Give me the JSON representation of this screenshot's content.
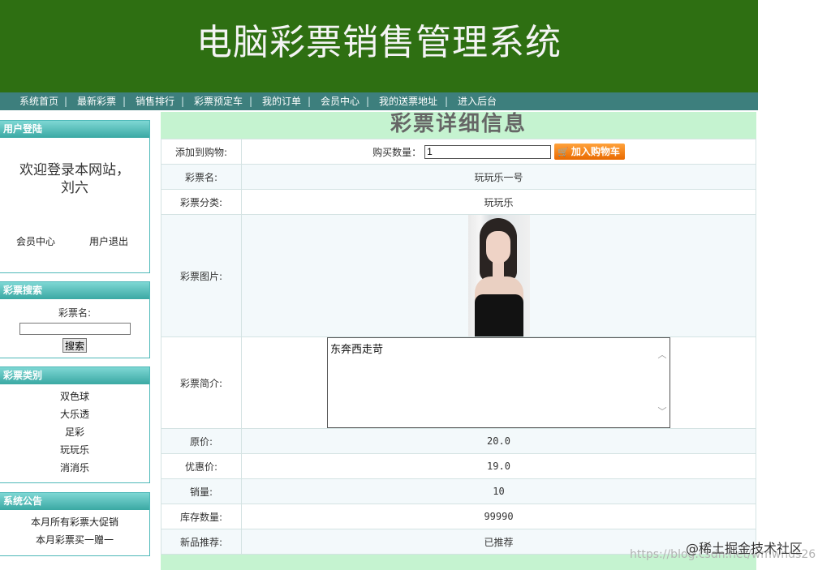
{
  "header": {
    "title": "电脑彩票销售管理系统"
  },
  "nav": {
    "items": [
      "系统首页",
      "最新彩票",
      "销售排行",
      "彩票预定车",
      "我的订单",
      "会员中心",
      "我的送票地址",
      "进入后台"
    ]
  },
  "login": {
    "title": "用户登陆",
    "welcome_line1": "欢迎登录本网站，",
    "welcome_line2": "刘六",
    "member_center": "会员中心",
    "logout": "用户退出"
  },
  "search": {
    "title": "彩票搜索",
    "label": "彩票名:",
    "value": "",
    "button": "搜索"
  },
  "categories": {
    "title": "彩票类别",
    "items": [
      "双色球",
      "大乐透",
      "足彩",
      "玩玩乐",
      "消消乐"
    ]
  },
  "notices": {
    "title": "系统公告",
    "items": [
      "本月所有彩票大促销",
      "本月彩票买一赠一"
    ]
  },
  "detail": {
    "title": "彩票详细信息",
    "cart_label": "添加到购物:",
    "qty_label": "购买数量：",
    "qty_value": "1",
    "cart_button": "加入购物车",
    "name_label": "彩票名:",
    "name_value": "玩玩乐一号",
    "category_label": "彩票分类:",
    "category_value": "玩玩乐",
    "image_label": "彩票图片:",
    "intro_label": "彩票简介:",
    "intro_value": "东奔西走苛",
    "price_label": "原价:",
    "price_value": "20.0",
    "discount_label": "优惠价:",
    "discount_value": "19.0",
    "sales_label": "销量:",
    "sales_value": "10",
    "stock_label": "库存数量:",
    "stock_value": "99990",
    "new_label": "新品推荐:",
    "new_value": "已推荐"
  },
  "watermark": {
    "text": "@稀土掘金技术社区",
    "url": "https://blog.csdn.net/wmwnds26"
  },
  "colors": {
    "header_bg": "#2e6f12",
    "nav_bg": "#3d7f7d",
    "main_bg": "#c5f3d0",
    "box_title": "#4eb8b8",
    "cart_button": "#f08a1c"
  },
  "icons": {
    "cart": "cart-icon",
    "scroll_up": "chevron-up-icon",
    "scroll_down": "chevron-down-icon"
  }
}
